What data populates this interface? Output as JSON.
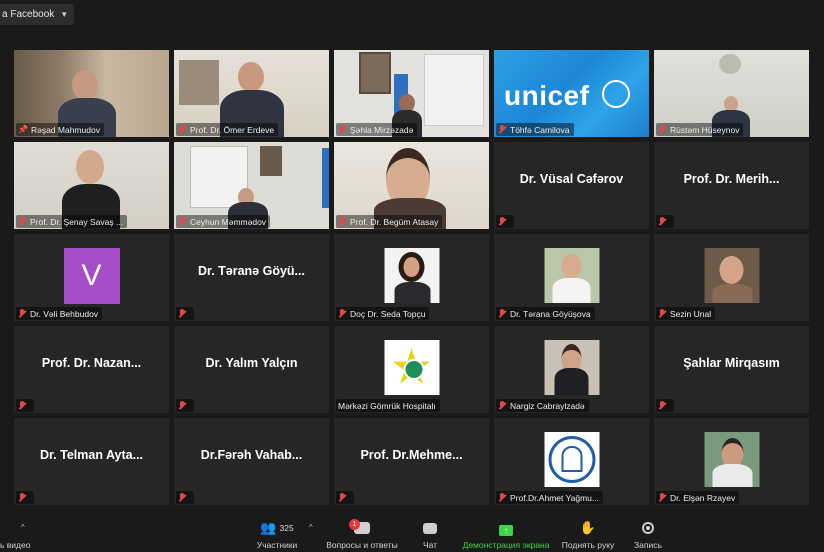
{
  "topbar": {
    "live_label": "a Facebook"
  },
  "tiles": [
    {
      "name": "Rəşad Mahmudov",
      "type": "video",
      "pinned": true,
      "active": true
    },
    {
      "name": "Prof. Dr. Ömer Erdeve",
      "type": "video"
    },
    {
      "name": "Şəhla Mirzəzadə",
      "type": "video"
    },
    {
      "name": "Töhfə Camilova",
      "type": "unicef",
      "logo_text": "unicef"
    },
    {
      "name": "Rüstəm Hüseynov",
      "type": "video"
    },
    {
      "name": "Prof. Dr. Şenay Savaş ...",
      "type": "video"
    },
    {
      "name": "Ceyhun Məmmədov",
      "type": "video"
    },
    {
      "name": "Prof. Dr. Begüm Atasay",
      "type": "video"
    },
    {
      "name": "",
      "type": "name",
      "center": "Dr. Vüsal Cəfərov"
    },
    {
      "name": "",
      "type": "name",
      "center": "Prof. Dr. Merih..."
    },
    {
      "name": "Dr. Vəli Behbudov",
      "type": "avatar",
      "letter": "V"
    },
    {
      "name": "",
      "type": "name",
      "center": "Dr. Təranə Göyü..."
    },
    {
      "name": "Doç Dr. Seda Topçu",
      "type": "photo"
    },
    {
      "name": "Dr. Tərana Göyüşova",
      "type": "photo"
    },
    {
      "name": "Sezin Unal",
      "type": "photo"
    },
    {
      "name": "",
      "type": "name",
      "center": "Prof. Dr. Nazan..."
    },
    {
      "name": "",
      "type": "name",
      "center": "Dr. Yalım Yalçın"
    },
    {
      "name": "Mərkəzi Gömrük Hospitalı",
      "type": "emblem"
    },
    {
      "name": "Nargiz Cabraylzadə",
      "type": "photo"
    },
    {
      "name": "",
      "type": "name",
      "center": "Şahlar Mirqasım"
    },
    {
      "name": "",
      "type": "name",
      "center": "Dr. Telman Ayta..."
    },
    {
      "name": "",
      "type": "name",
      "center": "Dr.Fərəh Vahab..."
    },
    {
      "name": "",
      "type": "name",
      "center": "Prof. Dr.Mehme..."
    },
    {
      "name": "Prof.Dr.Ahmet Yağmu...",
      "type": "seal"
    },
    {
      "name": "Dr. Elşən Rzayev",
      "type": "photo"
    }
  ],
  "toolbar": {
    "video_label": "ь видео",
    "participants_count": "325",
    "participants_label": "Участники",
    "qa_label": "Вопросы и ответы",
    "qa_badge": "1",
    "chat_label": "Чат",
    "share_label": "Демонстрация экрана",
    "raise_hand_label": "Поднять руку",
    "record_label": "Запись"
  },
  "colors": {
    "active_border": "#e8e84a",
    "mute_red": "#e0484d",
    "share_green": "#3fd34a",
    "avatar_purple": "#a54ec7"
  }
}
